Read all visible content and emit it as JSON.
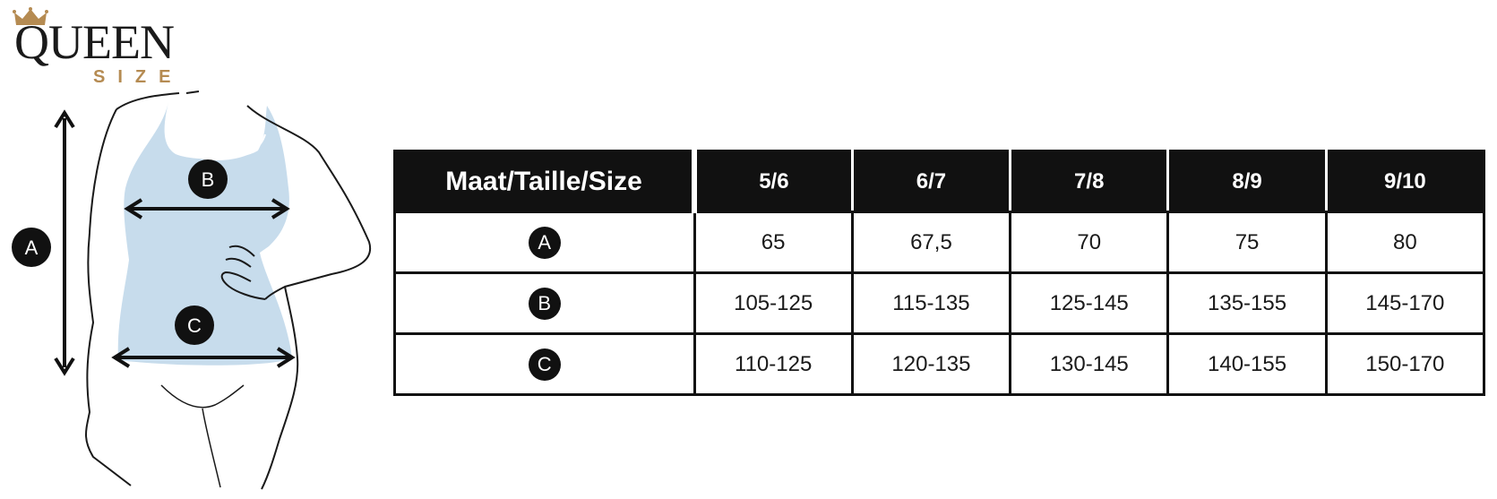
{
  "brand": {
    "name_top": "QUEEN",
    "name_bottom": "SIZE",
    "accent_color": "#b58b52"
  },
  "figure": {
    "labels": {
      "a": "A",
      "b": "B",
      "c": "C"
    },
    "body_fill": "#c7dcec"
  },
  "table": {
    "header_label": "Maat/Taille/Size",
    "sizes": [
      "5/6",
      "6/7",
      "7/8",
      "8/9",
      "9/10"
    ],
    "rows": [
      {
        "badge": "A",
        "values": [
          "65",
          "67,5",
          "70",
          "75",
          "80"
        ]
      },
      {
        "badge": "B",
        "values": [
          "105-125",
          "115-135",
          "125-145",
          "135-155",
          "145-170"
        ]
      },
      {
        "badge": "C",
        "values": [
          "110-125",
          "120-135",
          "130-145",
          "140-155",
          "150-170"
        ]
      }
    ]
  }
}
